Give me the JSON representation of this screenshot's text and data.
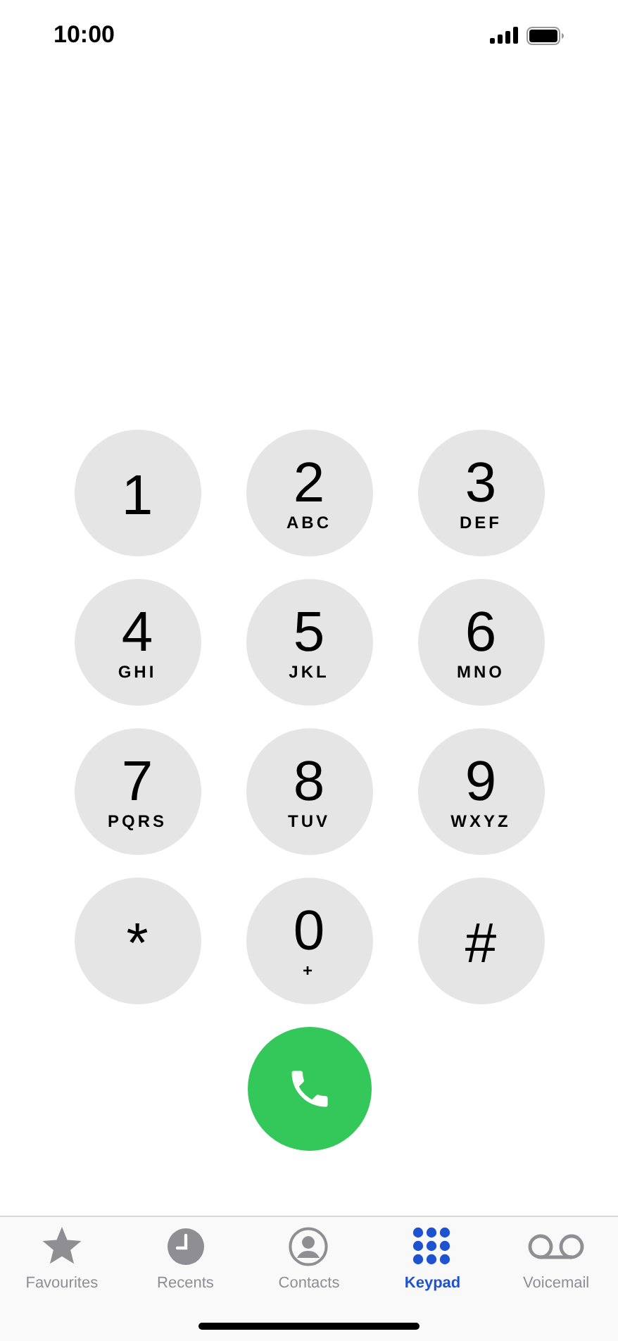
{
  "status_bar": {
    "time": "10:00"
  },
  "keys": [
    {
      "digit": "1"
    },
    {
      "digit": "2",
      "letters": "ABC"
    },
    {
      "digit": "3",
      "letters": "DEF"
    },
    {
      "digit": "4",
      "letters": "GHI"
    },
    {
      "digit": "5",
      "letters": "JKL"
    },
    {
      "digit": "6",
      "letters": "MNO"
    },
    {
      "digit": "7",
      "letters": "PQRS"
    },
    {
      "digit": "8",
      "letters": "TUV"
    },
    {
      "digit": "9",
      "letters": "WXYZ"
    },
    {
      "digit": "*"
    },
    {
      "digit": "0",
      "letters": "+"
    },
    {
      "digit": "#"
    }
  ],
  "tabs": [
    {
      "label": "Favourites",
      "kind": "favourites",
      "selected": false
    },
    {
      "label": "Recents",
      "kind": "recents",
      "selected": false
    },
    {
      "label": "Contacts",
      "kind": "contacts",
      "selected": false
    },
    {
      "label": "Keypad",
      "kind": "keypad",
      "selected": true
    },
    {
      "label": "Voicemail",
      "kind": "voicemail",
      "selected": false
    }
  ]
}
